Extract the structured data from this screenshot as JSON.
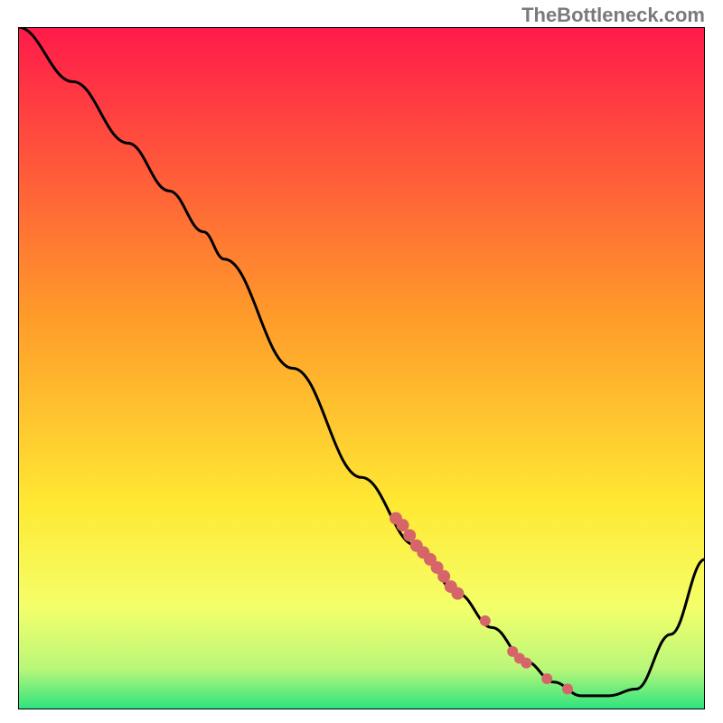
{
  "watermark": "TheBottleneck.com",
  "colors": {
    "gradient_top": "#ff1a4a",
    "gradient_mid1": "#ff8a2a",
    "gradient_mid2": "#ffe933",
    "gradient_band": "#f4ff6a",
    "gradient_green": "#2be37e",
    "line": "#000000",
    "dot": "#d6656a",
    "border": "#000000"
  },
  "chart_data": {
    "type": "line",
    "title": "",
    "xlabel": "",
    "ylabel": "",
    "xlim": [
      0,
      100
    ],
    "ylim": [
      0,
      100
    ],
    "grid": false,
    "legend": false,
    "series": [
      {
        "name": "curve",
        "x": [
          0,
          8,
          16,
          22,
          27,
          30,
          40,
          50,
          58,
          64,
          69,
          74,
          78,
          82,
          86,
          90,
          95,
          100
        ],
        "y": [
          100,
          92,
          83,
          76,
          70,
          66,
          50,
          34,
          24,
          17,
          12,
          7,
          4,
          2,
          2,
          3,
          11,
          22
        ]
      }
    ],
    "points": [
      {
        "x": 55,
        "y": 28
      },
      {
        "x": 56,
        "y": 27
      },
      {
        "x": 57,
        "y": 25.5
      },
      {
        "x": 58,
        "y": 24
      },
      {
        "x": 59,
        "y": 23
      },
      {
        "x": 60,
        "y": 22
      },
      {
        "x": 61,
        "y": 20.8
      },
      {
        "x": 62,
        "y": 19.5
      },
      {
        "x": 63,
        "y": 18
      },
      {
        "x": 64,
        "y": 17
      },
      {
        "x": 68,
        "y": 13
      },
      {
        "x": 72,
        "y": 8.5
      },
      {
        "x": 73,
        "y": 7.5
      },
      {
        "x": 74,
        "y": 6.8
      },
      {
        "x": 77,
        "y": 4.5
      },
      {
        "x": 80,
        "y": 3
      }
    ]
  }
}
